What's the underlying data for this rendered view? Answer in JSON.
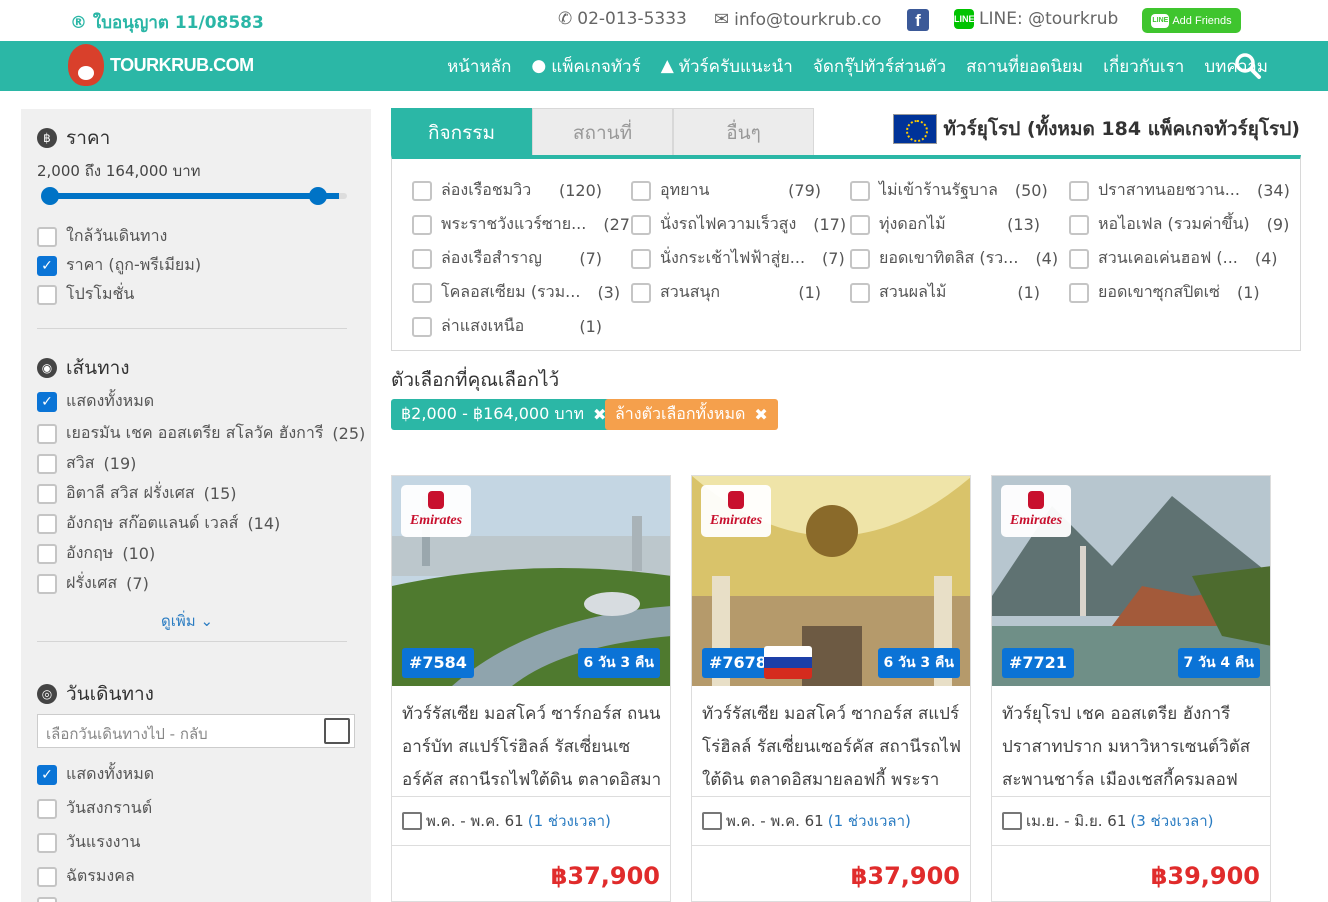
{
  "topbar": {
    "license": "® ใบอนุญาต 11/08583",
    "phone": "02-013-5333",
    "email": "info@tourkrub.co",
    "line": "LINE: @tourkrub",
    "add_friends": "Add Friends",
    "line_badge": "LINE"
  },
  "nav": {
    "logo": "TOURKRUB.COM",
    "items": [
      {
        "label": "หน้าหลัก"
      },
      {
        "label": "แพ็คเกจทัวร์"
      },
      {
        "label": "ทัวร์ครับแนะนำ"
      },
      {
        "label": "จัดกรุ๊ปทัวร์ส่วนตัว"
      },
      {
        "label": "สถานที่ยอดนิยม"
      },
      {
        "label": "เกี่ยวกับเรา"
      },
      {
        "label": "บทความ"
      }
    ]
  },
  "sidebar": {
    "price": {
      "title": "ราคา",
      "range_text": "2,000 ถึง 164,000 บาท",
      "range_min": 2000,
      "range_max": 164000,
      "selected_min": 2000,
      "selected_max": 164000,
      "sort": [
        {
          "label": "ใกล้วันเดินทาง",
          "checked": false
        },
        {
          "label": "ราคา (ถูก-พรีเมียม)",
          "checked": true
        },
        {
          "label": "โปรโมชั่น",
          "checked": false
        }
      ]
    },
    "route": {
      "title": "เส้นทาง",
      "items": [
        {
          "label": "แสดงทั้งหมด",
          "count": "",
          "checked": true
        },
        {
          "label": "เยอรมัน เชค ออสเตรีย สโลวัค ฮังการี",
          "count": "(25)",
          "checked": false
        },
        {
          "label": "สวิส",
          "count": "(19)",
          "checked": false
        },
        {
          "label": "อิตาลี สวิส ฝรั่งเศส",
          "count": "(15)",
          "checked": false
        },
        {
          "label": "อังกฤษ สก๊อตแลนด์ เวลส์",
          "count": "(14)",
          "checked": false
        },
        {
          "label": "อังกฤษ",
          "count": "(10)",
          "checked": false
        },
        {
          "label": "ฝรั่งเศส",
          "count": "(7)",
          "checked": false
        }
      ],
      "more": "ดูเพิ่ม"
    },
    "date": {
      "title": "วันเดินทาง",
      "placeholder": "เลือกวันเดินทางไป - กลับ",
      "items": [
        {
          "label": "แสดงทั้งหมด",
          "checked": true
        },
        {
          "label": "วันสงกรานต์",
          "checked": false
        },
        {
          "label": "วันแรงงาน",
          "checked": false
        },
        {
          "label": "ฉัตรมงคล",
          "checked": false
        }
      ]
    }
  },
  "tabs": [
    {
      "label": "กิจกรรม",
      "active": true
    },
    {
      "label": "สถานที่",
      "active": false
    },
    {
      "label": "อื่นๆ",
      "active": false
    }
  ],
  "region_title": "ทัวร์ยุโรป (ทั้งหมด 184 แพ็คเกจทัวร์ยุโรป)",
  "activities": [
    {
      "label": "ล่องเรือชมวิว",
      "count": "(120)"
    },
    {
      "label": "อุทยาน",
      "count": "(79)"
    },
    {
      "label": "ไม่เข้าร้านรัฐบาล",
      "count": "(50)"
    },
    {
      "label": "ปราสาทนอยชวาน...",
      "count": "(34)"
    },
    {
      "label": "พระราชวังแวร์ซาย...",
      "count": "(27)"
    },
    {
      "label": "นั่งรถไฟความเร็วสูง",
      "count": "(17)"
    },
    {
      "label": "ทุ่งดอกไม้",
      "count": "(13)"
    },
    {
      "label": "หอไอเฟล (รวมค่าขึ้น)",
      "count": "(9)"
    },
    {
      "label": "ล่องเรือสำราญ",
      "count": "(7)"
    },
    {
      "label": "นั่งกระเช้าไฟฟ้าสู่ย...",
      "count": "(7)"
    },
    {
      "label": "ยอดเขาทิตลิส (รว...",
      "count": "(4)"
    },
    {
      "label": "สวนเคอเค่นฮอฟ (...",
      "count": "(4)"
    },
    {
      "label": "โคลอสเซียม (รวม...",
      "count": "(3)"
    },
    {
      "label": "สวนสนุก",
      "count": "(1)"
    },
    {
      "label": "สวนผลไม้",
      "count": "(1)"
    },
    {
      "label": "ยอดเขาซุกสปิตเซ่",
      "count": "(1)"
    },
    {
      "label": "ล่าแสงเหนือ",
      "count": "(1)"
    }
  ],
  "chosen": {
    "title": "ตัวเลือกที่คุณเลือกไว้",
    "price_pill": "฿2,000 - ฿164,000 บาท",
    "clear_pill": "ล้างตัวเลือกทั้งหมด",
    "pill_color": "#2bb7a6",
    "clear_color": "#f5a04c"
  },
  "tours": [
    {
      "airline": "Emirates",
      "code": "#7584",
      "duration": "6 วัน 3 คืน",
      "title": "ทัวร์รัสเซีย มอสโคว์ ซาร์กอร์ส ถนนอาร์บัท สแปร์โร่ฮิลล์ รัสเซี่ยนเซอร์คัส สถานีรถไฟใต้ดิน ตลาดอิสมายลอฟ...",
      "period": "พ.ค. - พ.ค. 61",
      "slots": "(1 ช่วงเวลา)",
      "price": "฿37,900",
      "flag": false
    },
    {
      "airline": "Emirates",
      "code": "#7678",
      "duration": "6 วัน 3 คืน",
      "title": "ทัวร์รัสเซีย มอสโคว์ ซากอร์ส สแปร์โร่ฮิลล์ รัสเซี่ยนเซอร์คัส สถานีรถไฟใต้ดิน ตลาดอิสมายลอฟกี้ พระราชวังเครม...",
      "period": "พ.ค. - พ.ค. 61",
      "slots": "(1 ช่วงเวลา)",
      "price": "฿37,900",
      "flag": true
    },
    {
      "airline": "Emirates",
      "code": "#7721",
      "duration": "7 วัน 4 คืน",
      "title": "ทัวร์ยุโรป เชค ออสเตรีย ฮังการี ปราสาทปราก มหาวิหารเซนต์วิตัส สะพานชาร์ล เมืองเชสกี้ครมลอฟ ปรา...",
      "period": "เม.ย. - มิ.ย. 61",
      "slots": "(3 ช่วงเวลา)",
      "price": "฿39,900",
      "flag": false
    }
  ],
  "colors": {
    "brand": "#2bb7a6",
    "accent_blue": "#0b73d6",
    "price_red": "#e02b2b"
  }
}
